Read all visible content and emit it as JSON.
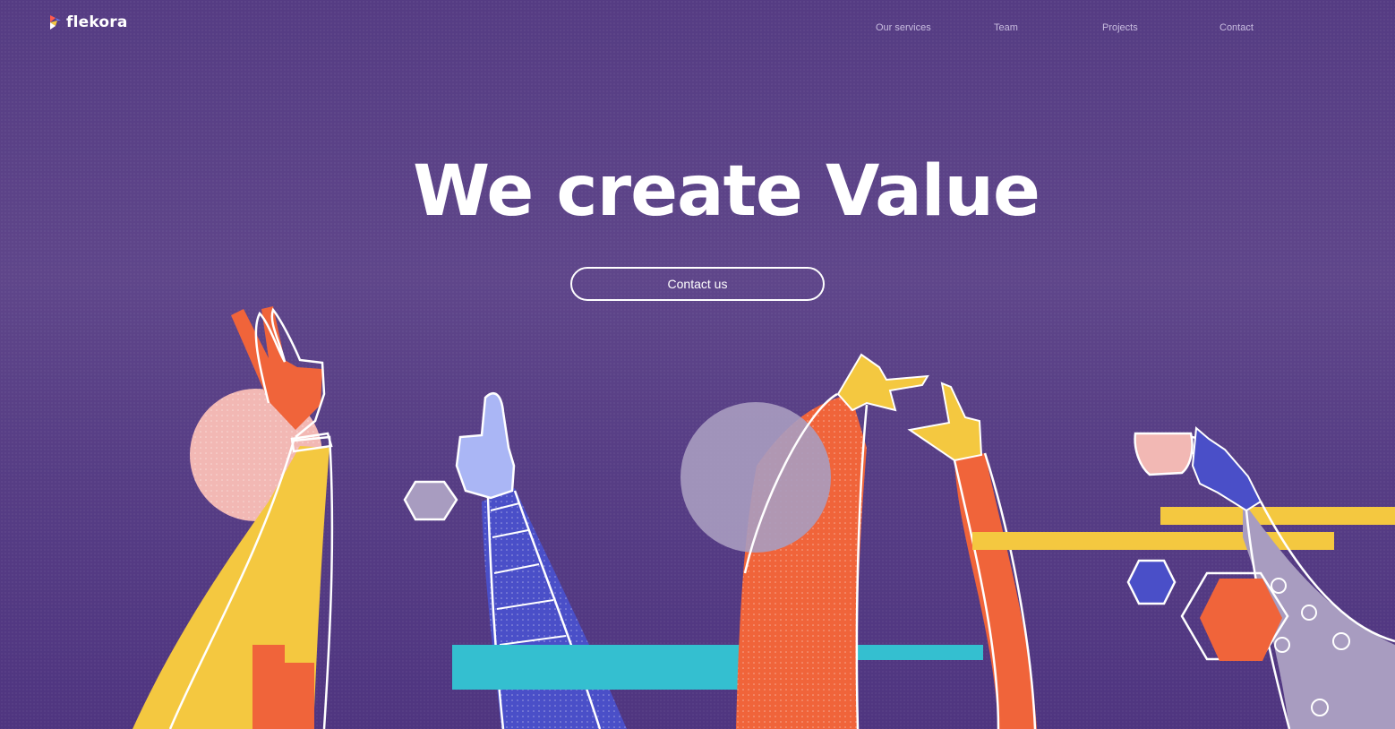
{
  "brand": {
    "name": "flekora",
    "icon": "flekora-logo-icon"
  },
  "nav": {
    "items": [
      {
        "label": "Our services"
      },
      {
        "label": "Team"
      },
      {
        "label": "Projects"
      },
      {
        "label": "Contact"
      }
    ]
  },
  "hero": {
    "title": "We create Value",
    "cta_label": "Contact us"
  },
  "colors": {
    "background": "#573e85",
    "accent_orange": "#f0643a",
    "accent_yellow": "#f4c840",
    "accent_blue": "#4a4fc8",
    "accent_cyan": "#34bfd0",
    "accent_pink": "#f2b8b4",
    "accent_lilac": "#a89cc0"
  }
}
